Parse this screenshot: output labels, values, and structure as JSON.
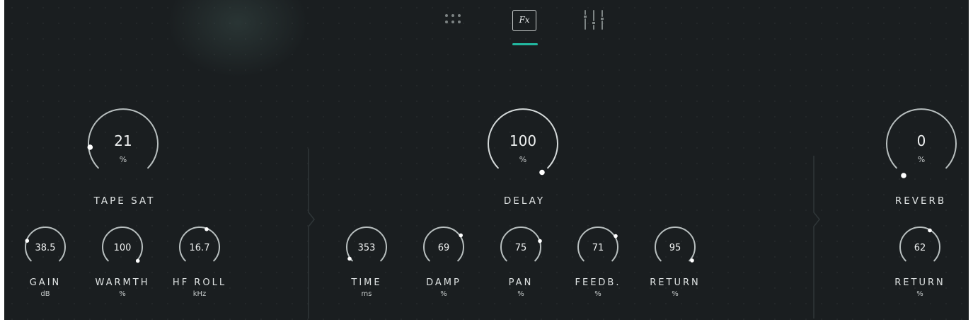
{
  "nav": {
    "tabs": [
      {
        "name": "grid-view-icon",
        "active": false
      },
      {
        "name": "fx-icon",
        "label": "Fx",
        "active": true
      },
      {
        "name": "mixer-icon",
        "active": false
      }
    ],
    "accent_color": "#22b8a0"
  },
  "tape_sat": {
    "label": "TAPE SAT",
    "main": {
      "value": "21",
      "unit": "%"
    },
    "gain": {
      "value": "38.5",
      "label": "GAIN",
      "unit": "dB"
    },
    "warmth": {
      "value": "100",
      "label": "WARMTH",
      "unit": "%"
    },
    "hf_roll": {
      "value": "16.7",
      "label": "HF ROLL",
      "unit": "kHz"
    }
  },
  "delay": {
    "label": "DELAY",
    "main": {
      "value": "100",
      "unit": "%"
    },
    "time": {
      "value": "353",
      "label": "TIME",
      "unit": "ms"
    },
    "damp": {
      "value": "69",
      "label": "DAMP",
      "unit": "%"
    },
    "pan": {
      "value": "75",
      "label": "PAN",
      "unit": "%"
    },
    "feedb": {
      "value": "71",
      "label": "FEEDB.",
      "unit": "%"
    },
    "return": {
      "value": "95",
      "label": "RETURN",
      "unit": "%"
    }
  },
  "reverb": {
    "label": "REVERB",
    "main": {
      "value": "0",
      "unit": "%"
    },
    "return": {
      "value": "62",
      "label": "RETURN",
      "unit": "%"
    }
  }
}
